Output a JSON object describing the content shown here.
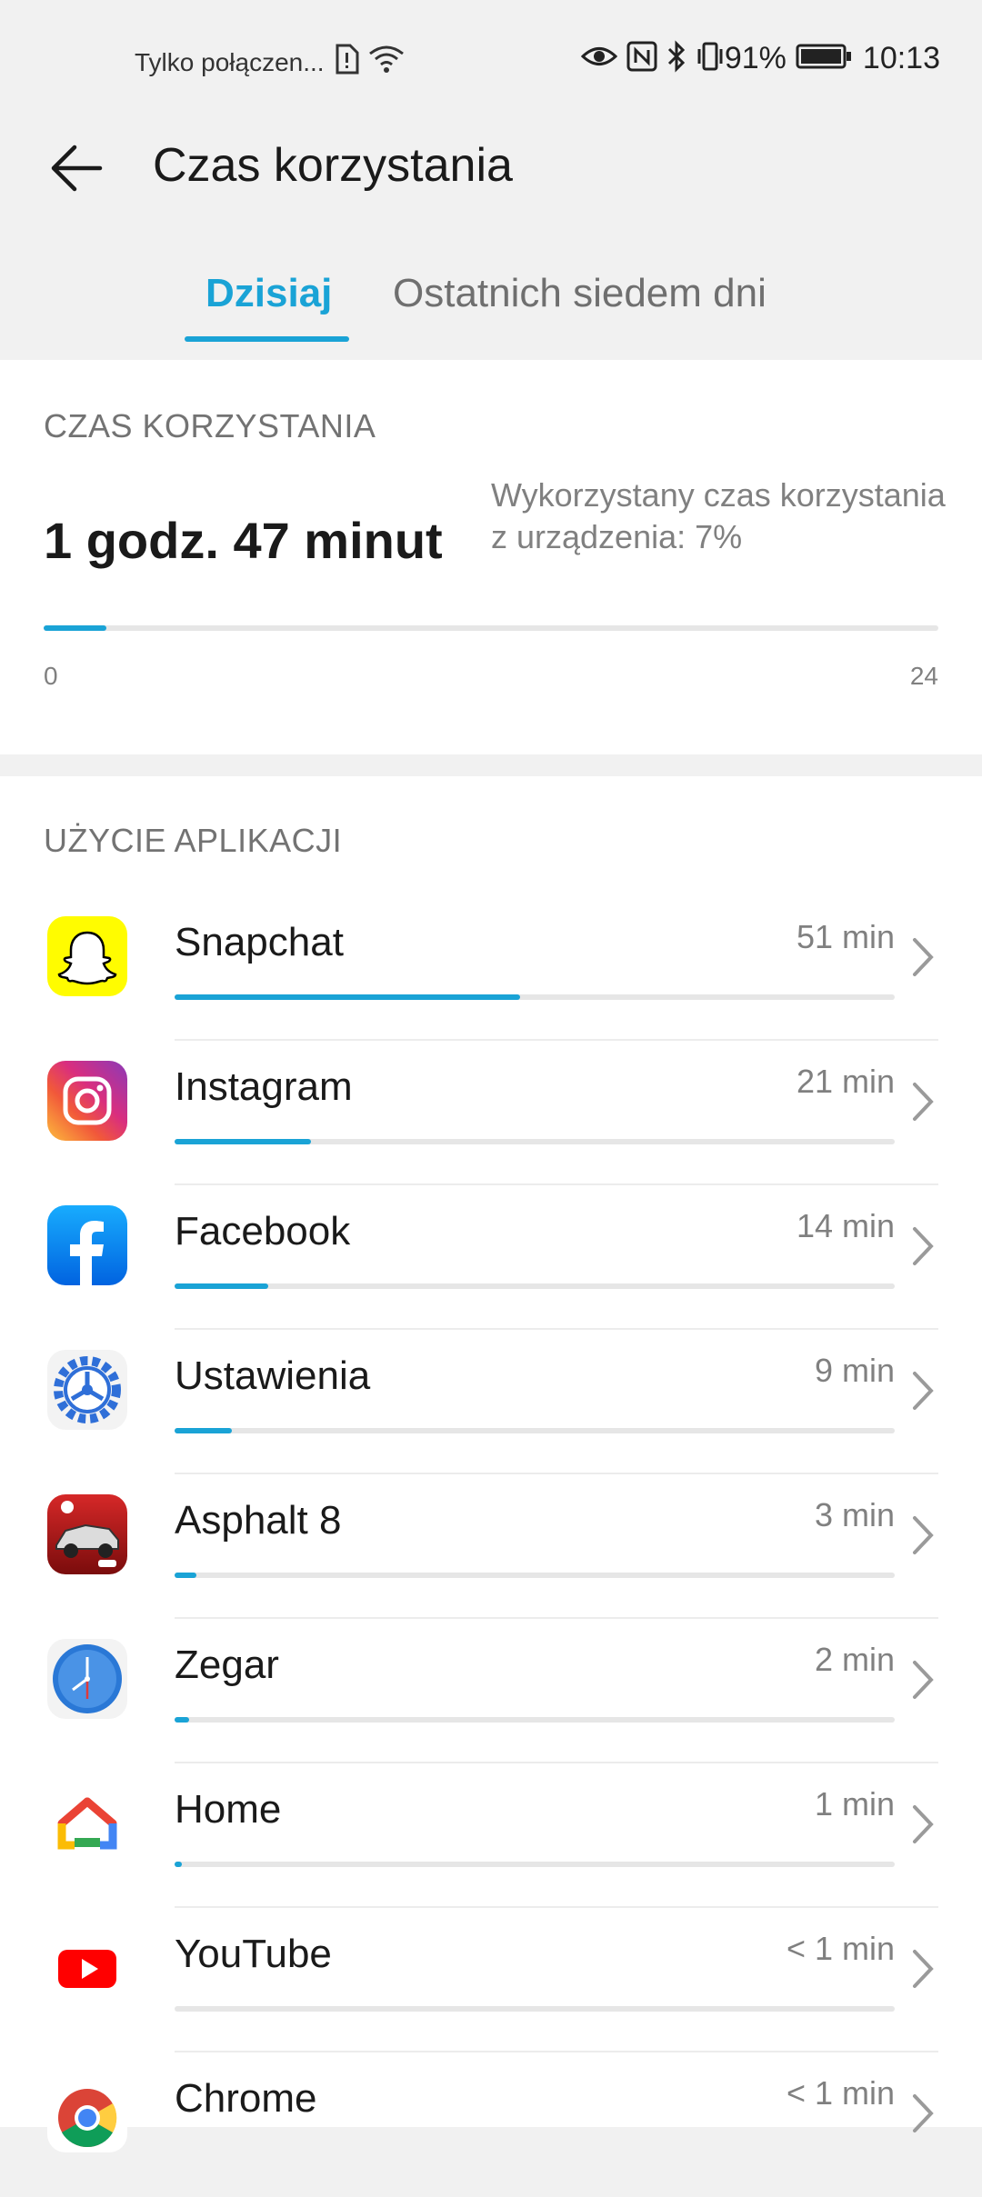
{
  "status_bar": {
    "network_text": "Tylko połączen...",
    "battery_percent": "91%",
    "time": "10:13"
  },
  "header": {
    "title": "Czas korzystania"
  },
  "tabs": [
    {
      "label": "Dzisiaj",
      "active": true
    },
    {
      "label": "Ostatnich siedem dni",
      "active": false
    }
  ],
  "screen_time": {
    "section_title": "CZAS KORZYSTANIA",
    "total": "1 godz. 47 minut",
    "usage_desc": "Wykorzystany czas korzystania z urządzenia: 7%",
    "progress": 0.07,
    "axis_min": "0",
    "axis_max": "24"
  },
  "app_usage": {
    "section_title": "UŻYCIE APLIKACJI",
    "apps": [
      {
        "name": "Snapchat",
        "time": "51 min",
        "progress": 0.48,
        "icon": "snapchat-icon"
      },
      {
        "name": "Instagram",
        "time": "21 min",
        "progress": 0.19,
        "icon": "instagram-icon"
      },
      {
        "name": "Facebook",
        "time": "14 min",
        "progress": 0.13,
        "icon": "facebook-icon"
      },
      {
        "name": "Ustawienia",
        "time": "9 min",
        "progress": 0.08,
        "icon": "settings-icon"
      },
      {
        "name": "Asphalt 8",
        "time": "3 min",
        "progress": 0.03,
        "icon": "asphalt-icon"
      },
      {
        "name": "Zegar",
        "time": "2 min",
        "progress": 0.02,
        "icon": "clock-icon"
      },
      {
        "name": "Home",
        "time": "1 min",
        "progress": 0.01,
        "icon": "google-home-icon"
      },
      {
        "name": "YouTube",
        "time": "< 1 min",
        "progress": 0.0,
        "icon": "youtube-icon"
      },
      {
        "name": "Chrome",
        "time": "< 1 min",
        "progress": 0.0,
        "icon": "chrome-icon"
      }
    ]
  },
  "colors": {
    "accent": "#1aa3d6",
    "background": "#f1f1f1",
    "card": "#ffffff"
  }
}
